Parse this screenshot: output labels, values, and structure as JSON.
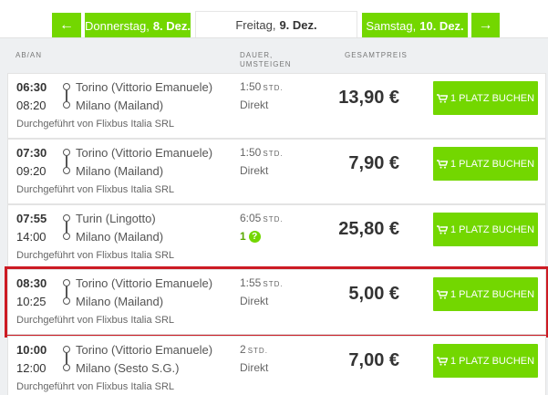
{
  "day_nav": {
    "prev_arrow": "←",
    "prev_day_label": "Donnerstag,",
    "prev_day_date": "8. Dez.",
    "current_day_label": "Freitag,",
    "current_day_date": "9. Dez.",
    "next_day_label": "Samstag,",
    "next_day_date": "10. Dez.",
    "next_arrow": "→"
  },
  "columns": {
    "time": "AB/AN",
    "duration_line1": "DAUER,",
    "duration_line2": "UMSTEIGEN",
    "price": "GESAMTPREIS"
  },
  "colors": {
    "accent": "#73d700",
    "highlight": "#cc1b24"
  },
  "rides": [
    {
      "dep": "06:30",
      "arr": "08:20",
      "from": "Torino (Vittorio Emanuele)",
      "to": "Milano (Mailand)",
      "operator": "Durchgeführt von Flixbus Italia SRL",
      "dur": "1:50",
      "dur_unit": "STD.",
      "transfer": "Direkt",
      "transfer_count": "",
      "price": "13,90 €",
      "button": "1 PLATZ BUCHEN",
      "highlighted": false
    },
    {
      "dep": "07:30",
      "arr": "09:20",
      "from": "Torino (Vittorio Emanuele)",
      "to": "Milano (Mailand)",
      "operator": "Durchgeführt von Flixbus Italia SRL",
      "dur": "1:50",
      "dur_unit": "STD.",
      "transfer": "Direkt",
      "transfer_count": "",
      "price": "7,90 €",
      "button": "1 PLATZ BUCHEN",
      "highlighted": false
    },
    {
      "dep": "07:55",
      "arr": "14:00",
      "from": "Turin (Lingotto)",
      "to": "Milano (Mailand)",
      "operator": "Durchgeführt von Flixbus Italia SRL",
      "dur": "6:05",
      "dur_unit": "STD.",
      "transfer": "",
      "transfer_count": "1",
      "price": "25,80 €",
      "button": "1 PLATZ BUCHEN",
      "highlighted": false
    },
    {
      "dep": "08:30",
      "arr": "10:25",
      "from": "Torino (Vittorio Emanuele)",
      "to": "Milano (Mailand)",
      "operator": "Durchgeführt von Flixbus Italia SRL",
      "dur": "1:55",
      "dur_unit": "STD.",
      "transfer": "Direkt",
      "transfer_count": "",
      "price": "5,00 €",
      "button": "1 PLATZ BUCHEN",
      "highlighted": true
    },
    {
      "dep": "10:00",
      "arr": "12:00",
      "from": "Torino (Vittorio Emanuele)",
      "to": "Milano (Sesto S.G.)",
      "operator": "Durchgeführt von Flixbus Italia SRL",
      "dur": "2",
      "dur_unit": "STD.",
      "transfer": "Direkt",
      "transfer_count": "",
      "price": "7,00 €",
      "button": "1 PLATZ BUCHEN",
      "highlighted": false
    }
  ]
}
